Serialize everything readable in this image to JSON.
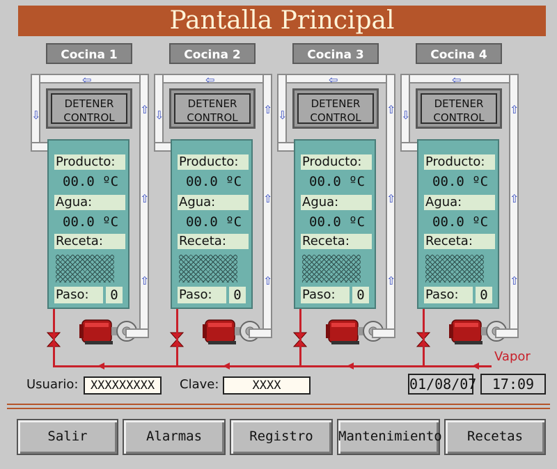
{
  "title": "Pantalla Principal",
  "cocinas": [
    {
      "name": "Cocina 1",
      "button": [
        "DETENER",
        "CONTROL"
      ],
      "producto_label": "Producto:",
      "producto_val": "00.0  ºC",
      "agua_label": "Agua:",
      "agua_val": "00.0  ºC",
      "receta_label": "Receta:",
      "paso_label": "Paso:",
      "paso_val": "0"
    },
    {
      "name": "Cocina 2",
      "button": [
        "DETENER",
        "CONTROL"
      ],
      "producto_label": "Producto:",
      "producto_val": "00.0  ºC",
      "agua_label": "Agua:",
      "agua_val": "00.0  ºC",
      "receta_label": "Receta:",
      "paso_label": "Paso:",
      "paso_val": "0"
    },
    {
      "name": "Cocina 3",
      "button": [
        "DETENER",
        "CONTROL"
      ],
      "producto_label": "Producto:",
      "producto_val": "00.0  ºC",
      "agua_label": "Agua:",
      "agua_val": "00.0  ºC",
      "receta_label": "Receta:",
      "paso_label": "Paso:",
      "paso_val": "0"
    },
    {
      "name": "Cocina 4",
      "button": [
        "DETENER",
        "CONTROL"
      ],
      "producto_label": "Producto:",
      "producto_val": "00.0  ºC",
      "agua_label": "Agua:",
      "agua_val": "00.0  ºC",
      "receta_label": "Receta:",
      "paso_label": "Paso:",
      "paso_val": "0"
    }
  ],
  "vapor_label": "Vapor",
  "usuario": {
    "label": "Usuario:",
    "value": "XXXXXXXXX"
  },
  "clave": {
    "label": "Clave:",
    "value": "XXXX"
  },
  "date": "01/08/07",
  "time": "17:09",
  "nav": [
    "Salir",
    "Alarmas",
    "Registro",
    "Mantenimiento",
    "Recetas"
  ],
  "colors": {
    "title_bar": "#b5552a",
    "tank": "#6fb2ac",
    "steam_line": "#c8202a",
    "pump": "#b01818"
  }
}
